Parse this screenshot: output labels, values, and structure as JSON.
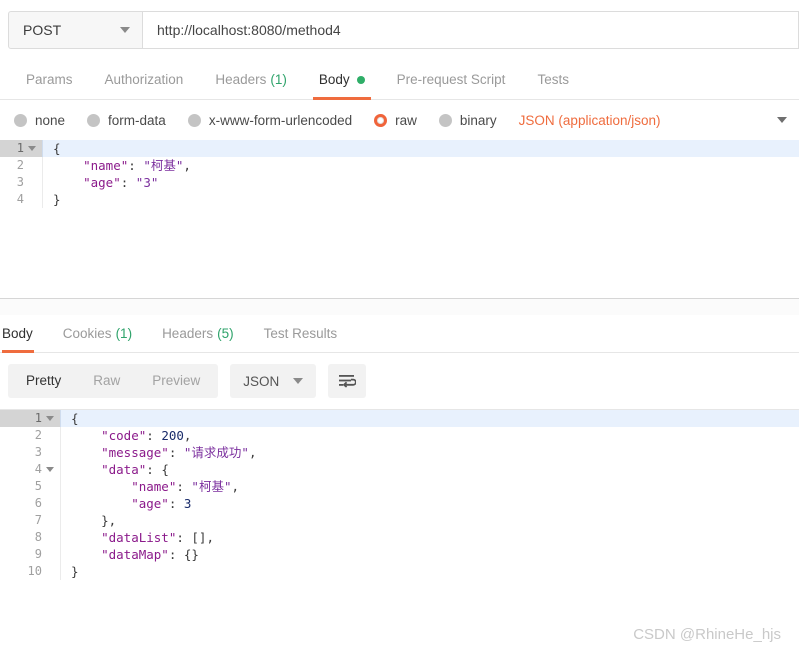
{
  "request": {
    "method": "POST",
    "method_caret_icon": "chevron-down-icon",
    "url": "http://localhost:8080/method4",
    "url_placeholder": "Enter request URL",
    "tabs": [
      {
        "label": "Params",
        "count": "",
        "active": false,
        "dot": false
      },
      {
        "label": "Authorization",
        "count": "",
        "active": false,
        "dot": false
      },
      {
        "label": "Headers",
        "count": "(1)",
        "active": false,
        "dot": false
      },
      {
        "label": "Body",
        "count": "",
        "active": true,
        "dot": true
      },
      {
        "label": "Pre-request Script",
        "count": "",
        "active": false,
        "dot": false
      },
      {
        "label": "Tests",
        "count": "",
        "active": false,
        "dot": false
      }
    ],
    "body_types": [
      {
        "label": "none",
        "checked": false
      },
      {
        "label": "form-data",
        "checked": false
      },
      {
        "label": "x-www-form-urlencoded",
        "checked": false
      },
      {
        "label": "raw",
        "checked": true
      },
      {
        "label": "binary",
        "checked": false
      }
    ],
    "content_type": "JSON (application/json)",
    "content_type_caret_icon": "chevron-down-icon",
    "body_lines": [
      {
        "num": "1",
        "fold": true,
        "active": true,
        "tokens": [
          {
            "t": "{",
            "c": "tok-punc"
          }
        ]
      },
      {
        "num": "2",
        "fold": false,
        "active": false,
        "tokens": [
          {
            "t": "    \"name\"",
            "c": "tok-key"
          },
          {
            "t": ": ",
            "c": "tok-punc"
          },
          {
            "t": "\"柯基\"",
            "c": "tok-str"
          },
          {
            "t": ",",
            "c": "tok-punc"
          }
        ]
      },
      {
        "num": "3",
        "fold": false,
        "active": false,
        "tokens": [
          {
            "t": "    \"age\"",
            "c": "tok-key"
          },
          {
            "t": ": ",
            "c": "tok-punc"
          },
          {
            "t": "\"3\"",
            "c": "tok-str"
          }
        ]
      },
      {
        "num": "4",
        "fold": false,
        "active": false,
        "tokens": [
          {
            "t": "}",
            "c": "tok-punc"
          }
        ]
      }
    ]
  },
  "response": {
    "tabs": [
      {
        "label": "Body",
        "count": "",
        "active": true
      },
      {
        "label": "Cookies",
        "count": "(1)",
        "active": false
      },
      {
        "label": "Headers",
        "count": "(5)",
        "active": false
      },
      {
        "label": "Test Results",
        "count": "",
        "active": false
      }
    ],
    "view_modes": [
      {
        "label": "Pretty",
        "active": true
      },
      {
        "label": "Raw",
        "active": false
      },
      {
        "label": "Preview",
        "active": false
      }
    ],
    "format": "JSON",
    "format_caret_icon": "chevron-down-icon",
    "wrap_button_icon": "word-wrap-icon",
    "body_lines": [
      {
        "num": "1",
        "fold": true,
        "active": true,
        "tokens": [
          {
            "t": "{",
            "c": "tok-punc"
          }
        ]
      },
      {
        "num": "2",
        "fold": false,
        "active": false,
        "tokens": [
          {
            "t": "    \"code\"",
            "c": "tok-key"
          },
          {
            "t": ": ",
            "c": "tok-punc"
          },
          {
            "t": "200",
            "c": "tok-num"
          },
          {
            "t": ",",
            "c": "tok-punc"
          }
        ]
      },
      {
        "num": "3",
        "fold": false,
        "active": false,
        "tokens": [
          {
            "t": "    \"message\"",
            "c": "tok-key"
          },
          {
            "t": ": ",
            "c": "tok-punc"
          },
          {
            "t": "\"请求成功\"",
            "c": "tok-str"
          },
          {
            "t": ",",
            "c": "tok-punc"
          }
        ]
      },
      {
        "num": "4",
        "fold": true,
        "active": false,
        "tokens": [
          {
            "t": "    \"data\"",
            "c": "tok-key"
          },
          {
            "t": ": {",
            "c": "tok-punc"
          }
        ]
      },
      {
        "num": "5",
        "fold": false,
        "active": false,
        "tokens": [
          {
            "t": "        \"name\"",
            "c": "tok-key"
          },
          {
            "t": ": ",
            "c": "tok-punc"
          },
          {
            "t": "\"柯基\"",
            "c": "tok-str"
          },
          {
            "t": ",",
            "c": "tok-punc"
          }
        ]
      },
      {
        "num": "6",
        "fold": false,
        "active": false,
        "tokens": [
          {
            "t": "        \"age\"",
            "c": "tok-key"
          },
          {
            "t": ": ",
            "c": "tok-punc"
          },
          {
            "t": "3",
            "c": "tok-num"
          }
        ]
      },
      {
        "num": "7",
        "fold": false,
        "active": false,
        "tokens": [
          {
            "t": "    },",
            "c": "tok-punc"
          }
        ]
      },
      {
        "num": "8",
        "fold": false,
        "active": false,
        "tokens": [
          {
            "t": "    \"dataList\"",
            "c": "tok-key"
          },
          {
            "t": ": [],",
            "c": "tok-punc"
          }
        ]
      },
      {
        "num": "9",
        "fold": false,
        "active": false,
        "tokens": [
          {
            "t": "    \"dataMap\"",
            "c": "tok-key"
          },
          {
            "t": ": {}",
            "c": "tok-punc"
          }
        ]
      },
      {
        "num": "10",
        "fold": false,
        "active": false,
        "tokens": [
          {
            "t": "}",
            "c": "tok-punc"
          }
        ]
      }
    ]
  },
  "watermark": "CSDN @RhineHe_hjs",
  "colors": {
    "accent_orange": "#ef6c3e",
    "dot_green": "#2fae68",
    "count_green": "#2fa36b",
    "active_line_blue": "#e8f1fd"
  }
}
